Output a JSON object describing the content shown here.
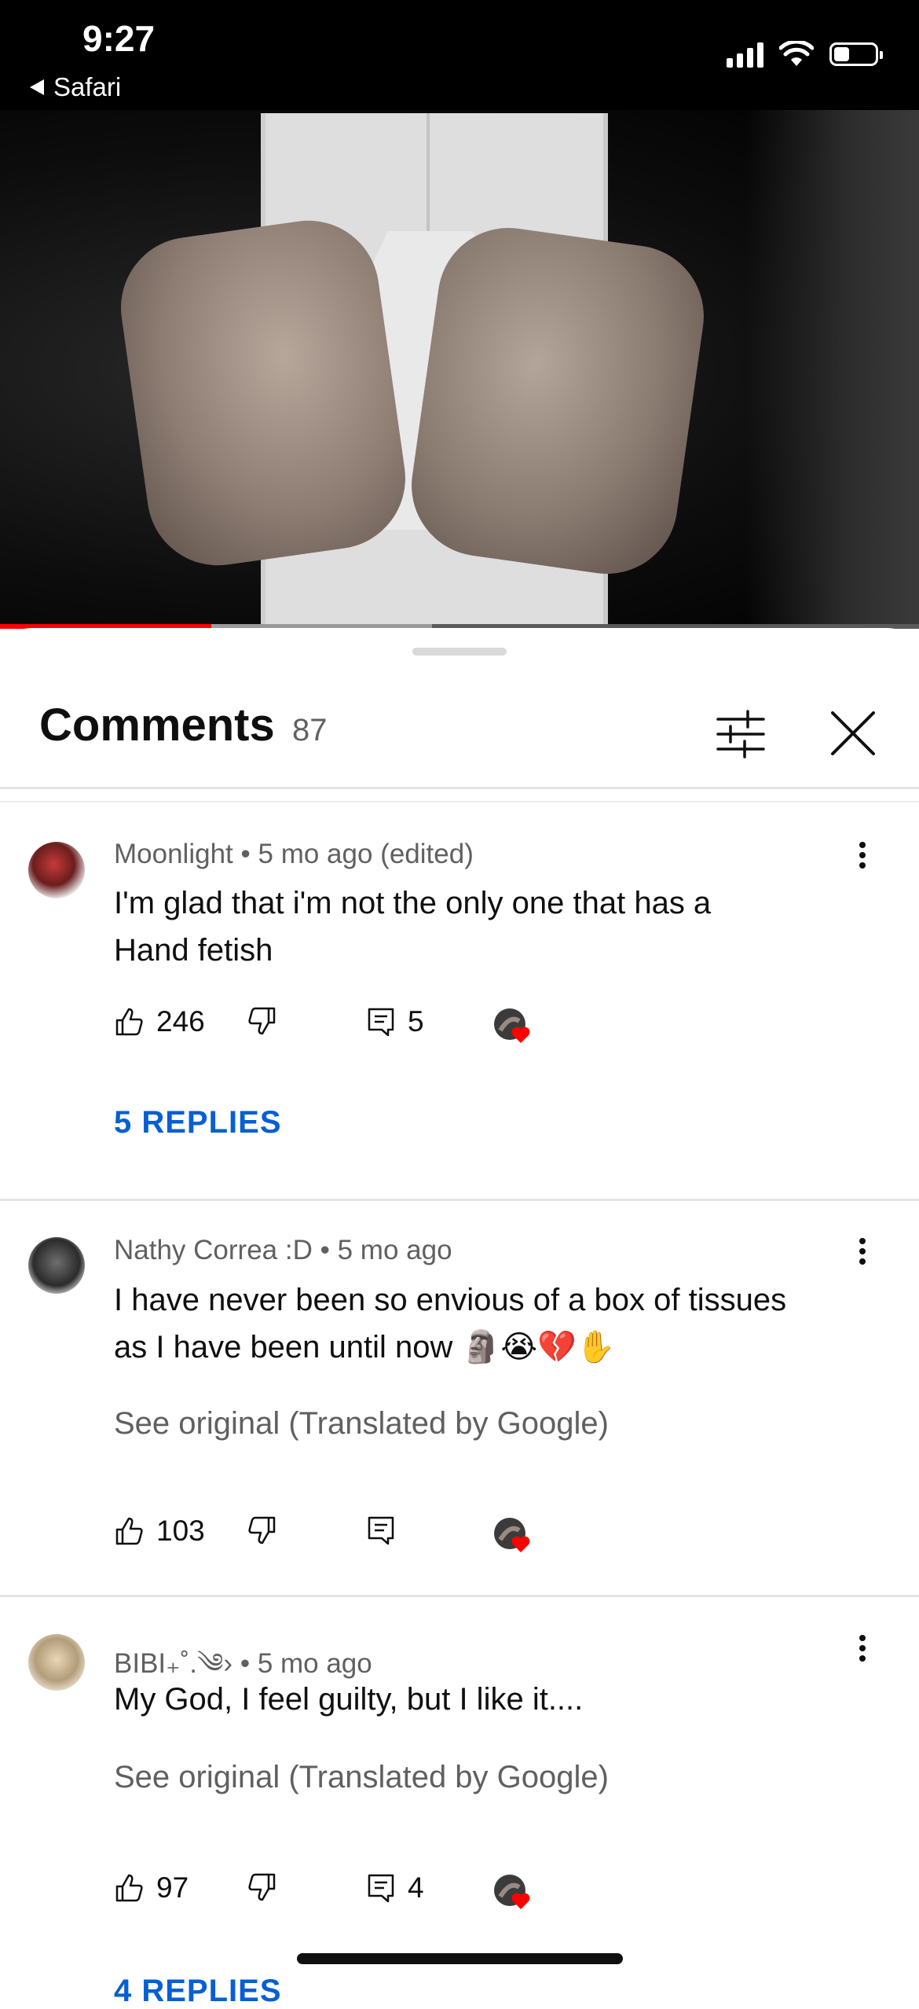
{
  "status_bar": {
    "time": "9:27",
    "back_app": "Safari",
    "battery_level": 0.45
  },
  "video": {
    "progress": 0.23,
    "buffered": 0.47
  },
  "sheet": {
    "title": "Comments",
    "count": "87"
  },
  "comments": [
    {
      "author": "Moonlight",
      "time": "5 mo ago",
      "edited": "(edited)",
      "text_line1": "I'm glad that i'm not the only one that has a",
      "text_line2": "Hand fetish",
      "likes": "246",
      "reply_count": "5",
      "replies_label": "5 REPLIES"
    },
    {
      "author": "Nathy Correa :D",
      "time": "5 mo ago",
      "text_line1": "I have never been so envious of a box of tissues",
      "text_line2": "as I have been until now 🗿😭💔✋",
      "translate_label": "See original (Translated by Google)",
      "likes": "103"
    },
    {
      "author": "BIBI₊˚.༄›",
      "time": "5 mo ago",
      "text_line1": "My God, I feel guilty, but I like it....",
      "translate_label": "See original (Translated by Google)",
      "likes": "97",
      "reply_count": "4",
      "replies_label": "4 REPLIES"
    }
  ],
  "separator": "•",
  "colors": {
    "accent_blue": "#065fd4",
    "progress_red": "#ff0000",
    "heart_red": "#ff0000"
  },
  "icons": [
    "back-triangle-icon",
    "signal-icon",
    "wifi-icon",
    "battery-icon",
    "filter-sliders-icon",
    "close-icon",
    "more-vert-icon",
    "thumb-up-icon",
    "thumb-down-icon",
    "comment-icon",
    "heart-icon"
  ]
}
